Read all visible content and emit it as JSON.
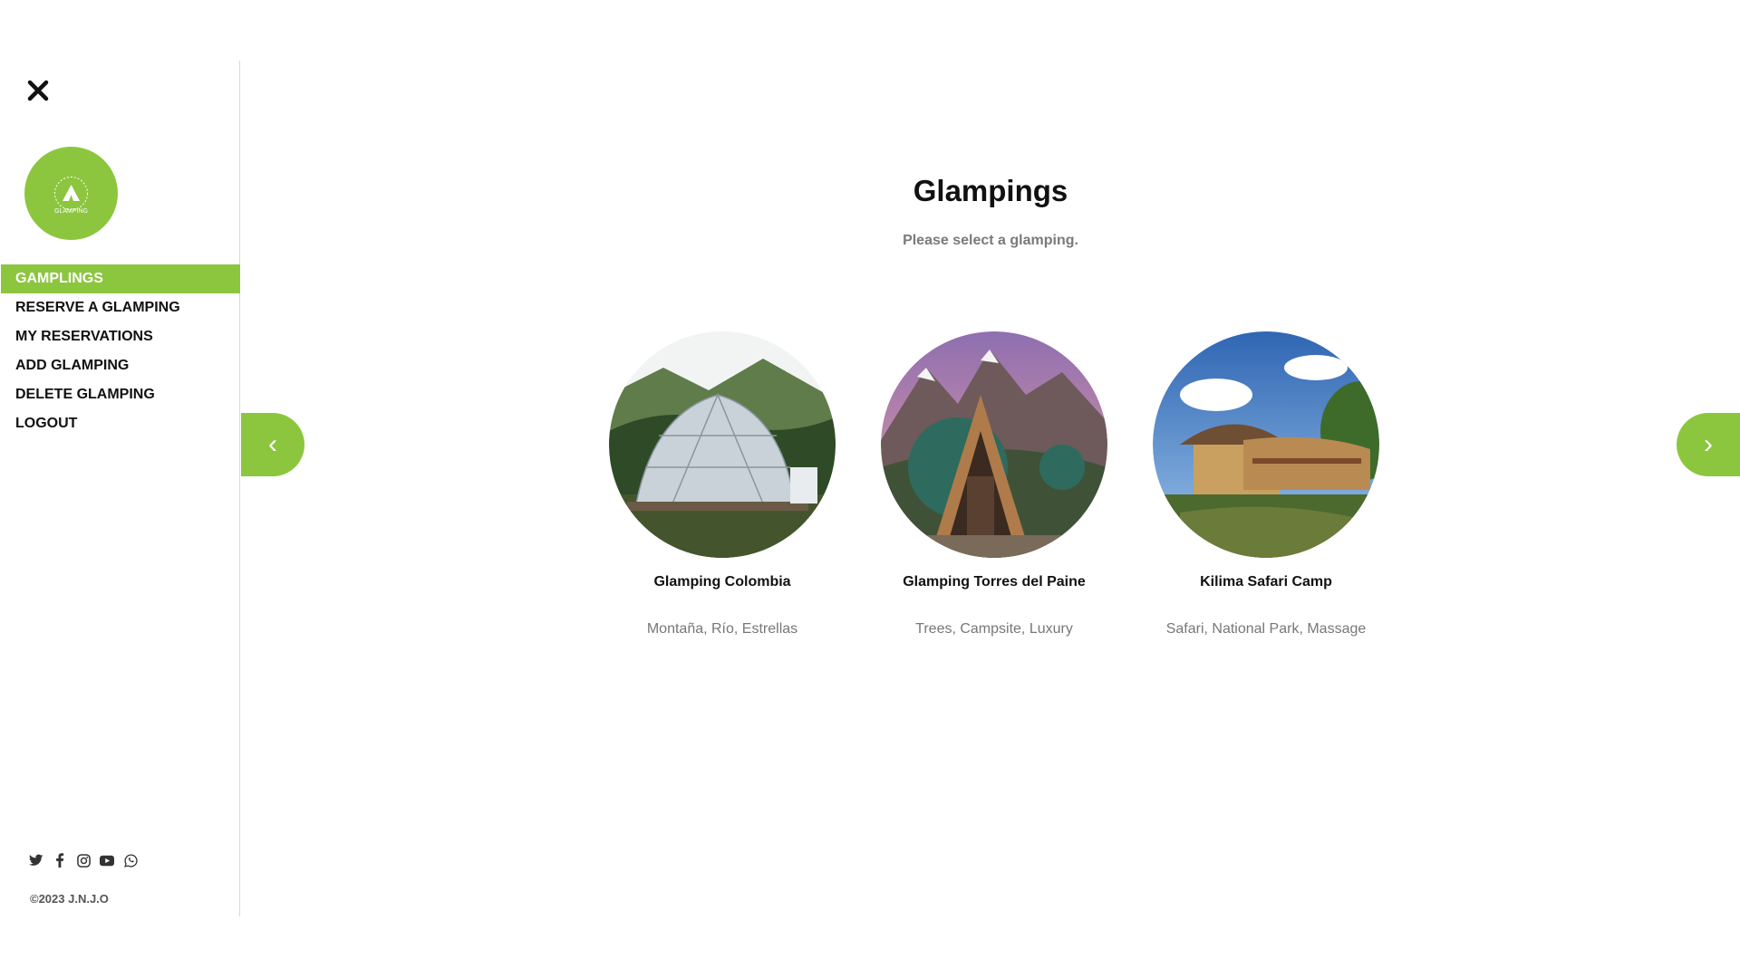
{
  "sidebar": {
    "close_icon": "close-icon",
    "logo_text": "GLAMPING",
    "nav": [
      {
        "label": "GAMPLINGS",
        "active": true
      },
      {
        "label": "RESERVE A GLAMPING",
        "active": false
      },
      {
        "label": "MY RESERVATIONS",
        "active": false
      },
      {
        "label": "ADD GLAMPING",
        "active": false
      },
      {
        "label": "DELETE GLAMPING",
        "active": false
      },
      {
        "label": "LOGOUT",
        "active": false
      }
    ],
    "social_icons": [
      "twitter-icon",
      "facebook-icon",
      "instagram-icon",
      "youtube-icon",
      "whatsapp-icon"
    ],
    "copyright": "©2023 J.N.J.O"
  },
  "main": {
    "title": "Glampings",
    "subtitle": "Please select a glamping.",
    "prev_label": "‹",
    "next_label": "›",
    "cards": [
      {
        "name": "Glamping Colombia",
        "tags": "Montaña, Río, Estrellas"
      },
      {
        "name": "Glamping Torres del Paine",
        "tags": "Trees, Campsite, Luxury"
      },
      {
        "name": "Kilima Safari Camp",
        "tags": "Safari, National Park, Massage"
      }
    ]
  },
  "colors": {
    "accent": "#8cc63f",
    "text": "#111111",
    "muted": "#777777"
  }
}
